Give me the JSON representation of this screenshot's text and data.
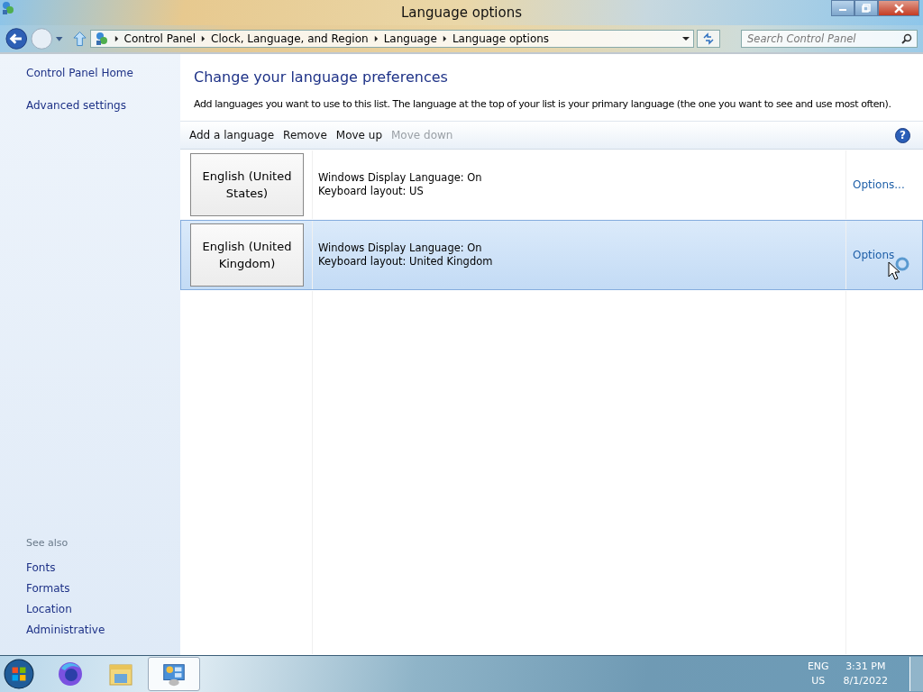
{
  "window": {
    "title": "Language options"
  },
  "address_bar": {
    "breadcrumbs": [
      "Control Panel",
      "Clock, Language, and Region",
      "Language",
      "Language options"
    ]
  },
  "search": {
    "placeholder": "Search Control Panel"
  },
  "sidebar": {
    "items": [
      {
        "label": "Control Panel Home"
      },
      {
        "label": "Advanced settings"
      }
    ],
    "see_also_heading": "See also",
    "see_also": [
      {
        "label": "Fonts"
      },
      {
        "label": "Formats"
      },
      {
        "label": "Location"
      },
      {
        "label": "Administrative"
      }
    ]
  },
  "content": {
    "heading": "Change your language preferences",
    "description": "Add languages you want to use to this list. The language at the top of your list is your primary language (the one you want to see and use most often)."
  },
  "toolbar": [
    {
      "label": "Add a language",
      "disabled": false
    },
    {
      "label": "Remove",
      "disabled": false
    },
    {
      "label": "Move up",
      "disabled": false
    },
    {
      "label": "Move down",
      "disabled": true
    }
  ],
  "help": "?",
  "languages": [
    {
      "name": "English (United States)",
      "display_language": "Windows Display Language: On",
      "keyboard": "Keyboard layout: US",
      "options": "Options...",
      "selected": false
    },
    {
      "name": "English (United Kingdom)",
      "display_language": "Windows Display Language: On",
      "keyboard": "Keyboard layout: United Kingdom",
      "options": "Options",
      "selected": true
    }
  ],
  "taskbar": {
    "input_language": "ENG",
    "keyboard": "US",
    "time": "3:31 PM",
    "date": "8/1/2022"
  }
}
